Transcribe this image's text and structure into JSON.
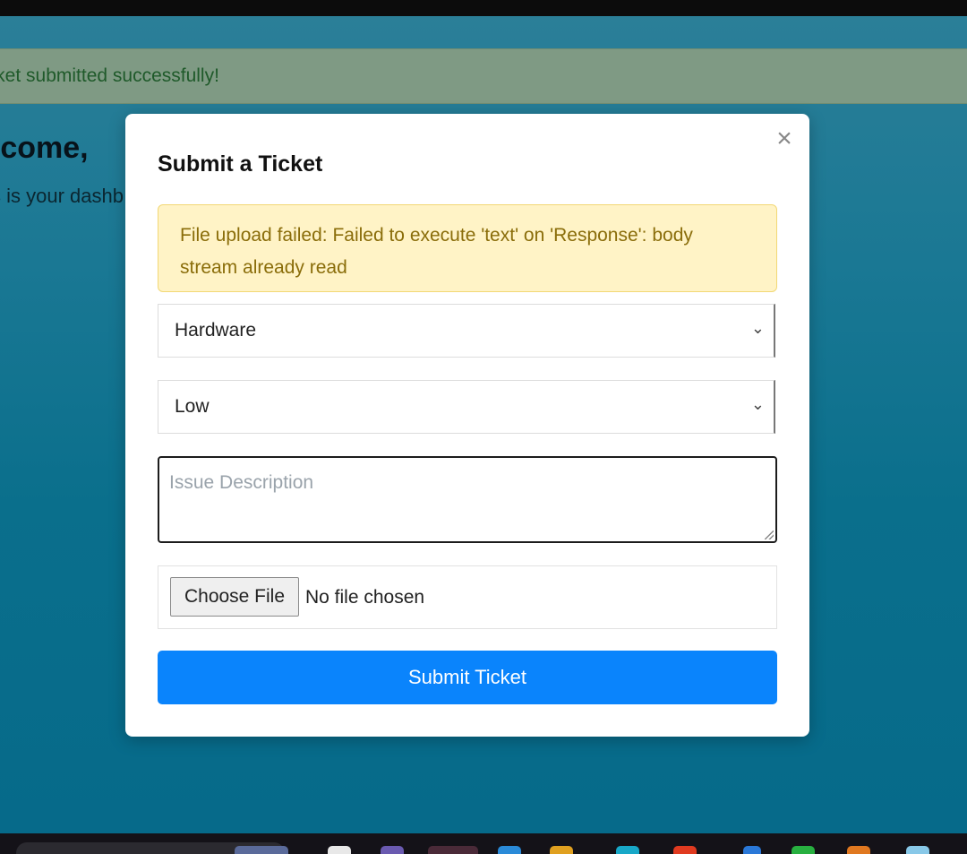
{
  "background": {
    "banner_text": "icket submitted successfully!",
    "welcome_text": "elcome, ",
    "subtitle_text": "s is your dashb"
  },
  "modal": {
    "title": "Submit a Ticket",
    "close_label": "×",
    "warning_text": "File upload failed: Failed to execute 'text' on 'Response': body stream already read",
    "category_value": "Hardware",
    "priority_value": "Low",
    "description_placeholder": "Issue Description",
    "file_button_label": "Choose File",
    "file_status": "No file chosen",
    "submit_label": "Submit Ticket",
    "chevron": "⌄"
  },
  "colors": {
    "accent": "#0a84fc",
    "success_bg": "#7f9a84",
    "warning_bg": "#fff3c6",
    "warning_text": "#8a6d0a"
  },
  "taskbar": {
    "icons": [
      "search-box",
      "app-icon",
      "app-icon",
      "app-icon",
      "app-icon",
      "app-icon",
      "app-icon",
      "app-icon",
      "app-icon",
      "app-icon",
      "app-icon",
      "app-icon",
      "app-icon"
    ]
  }
}
